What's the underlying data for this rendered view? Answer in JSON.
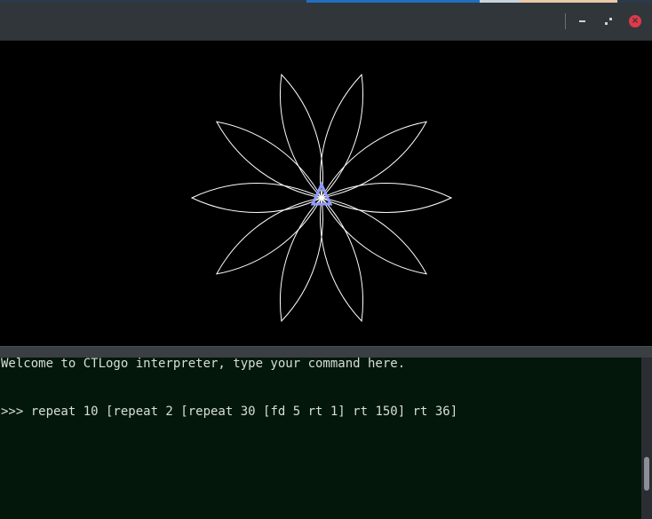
{
  "window": {
    "buttons": {
      "minimize_icon": "minimize-icon",
      "maximize_icon": "maximize-icon",
      "close_icon": "close-icon",
      "close_glyph": "×"
    }
  },
  "canvas": {
    "background": "#000000",
    "stroke_color": "#ffffff",
    "turtle_color": "#8f9cff",
    "petal_count": 10,
    "turn_between_petals_deg": 36
  },
  "console": {
    "background": "#04170b",
    "text_color": "#d6dfd6",
    "welcome": "Welcome to CTLogo interpreter, type your command here.",
    "prompt": ">>> ",
    "command": "repeat 10 [repeat 2 [repeat 30 [fd 5 rt 1] rt 150] rt 36]"
  }
}
